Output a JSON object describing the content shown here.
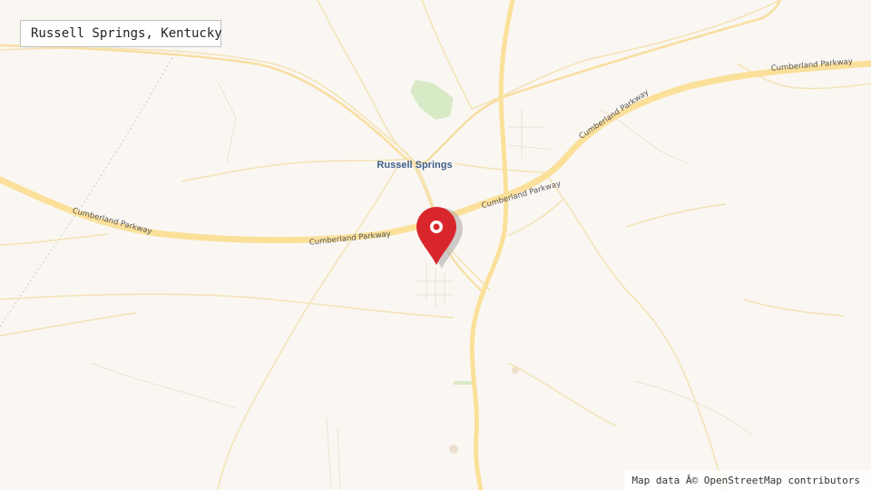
{
  "title": "Russell Springs, Kentucky",
  "place_label": "Russell Springs",
  "road_labels": {
    "east_upper": "Cumberland Parkway",
    "east_mid": "Cumberland Parkway",
    "center": "Cumberland Parkway",
    "center_west": "Cumberland Parkway",
    "west": "Cumberland Parkway"
  },
  "attribution": "Map data Â© OpenStreetMap contributors",
  "marker": {
    "icon": "map-pin-icon",
    "color": "#d9262c"
  },
  "colors": {
    "background": "#faf7f3",
    "major_road": "#fbe09a",
    "minor_road": "#f5e6b8",
    "park": "#d8e9c6",
    "place_label": "#3f5f8c"
  }
}
